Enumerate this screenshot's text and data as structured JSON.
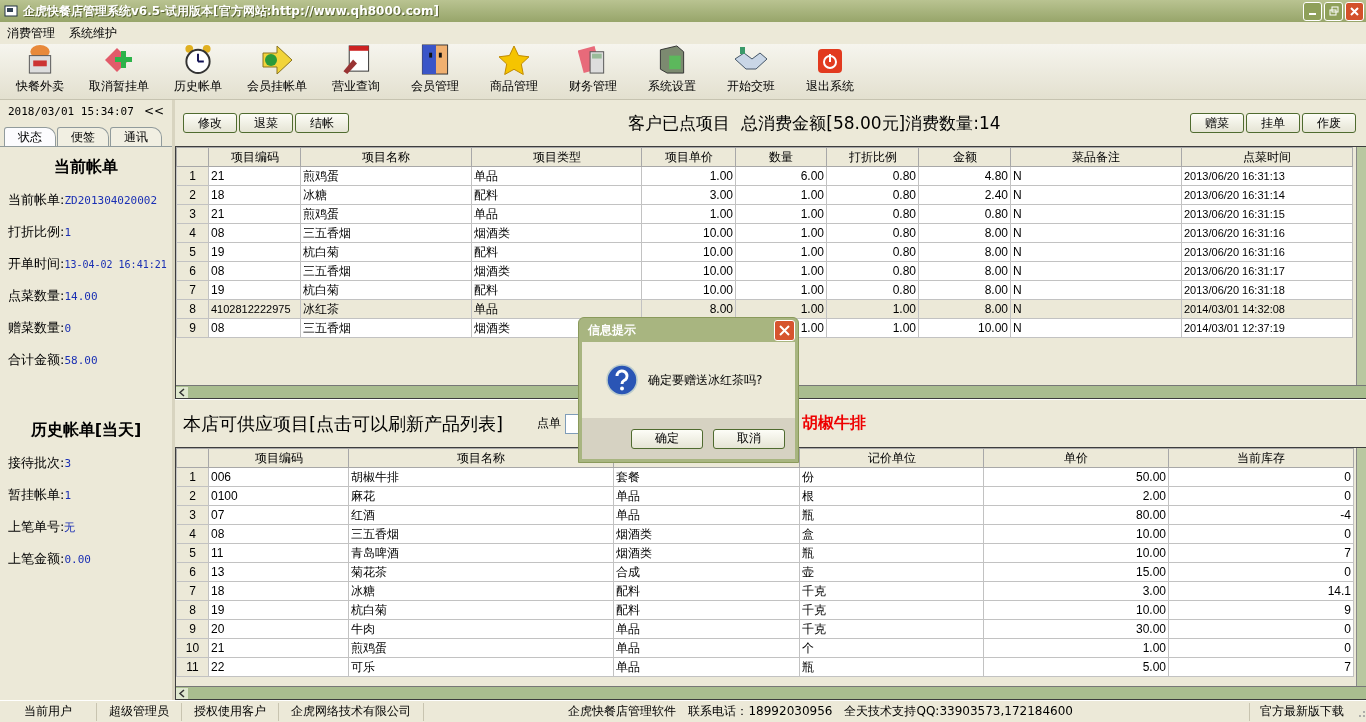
{
  "window": {
    "title": "企虎快餐店管理系统v6.5-试用版本[官方网站:http://www.qh8000.com]"
  },
  "menu": [
    "消费管理",
    "系统维护"
  ],
  "toolbar": [
    "快餐外卖",
    "取消暂挂单",
    "历史帐单",
    "会员挂帐单",
    "营业查询",
    "会员管理",
    "商品管理",
    "财务管理",
    "系统设置",
    "开始交班",
    "退出系统"
  ],
  "sidebar": {
    "datetime": "2018/03/01 15:34:07",
    "collapse": "<<",
    "tabs": [
      {
        "label": "状态",
        "selected": true
      },
      {
        "label": "便签",
        "selected": false
      },
      {
        "label": "通讯",
        "selected": false
      }
    ],
    "sections": [
      {
        "title": "当前帐单",
        "fields": [
          {
            "label": "当前帐单:",
            "value": "ZD201304020002"
          },
          {
            "label": "打折比例:",
            "value": "1"
          },
          {
            "label": "开单时间:",
            "value": "13-04-02 16:41:21"
          },
          {
            "label": "点菜数量:",
            "value": "14.00"
          },
          {
            "label": "赠菜数量:",
            "value": "0"
          },
          {
            "label": "合计金额:",
            "value": "58.00"
          }
        ]
      },
      {
        "title": "历史帐单[当天]",
        "fields": [
          {
            "label": "接待批次:",
            "value": "3"
          },
          {
            "label": "暂挂帐单:",
            "value": "1"
          },
          {
            "label": "上笔单号:",
            "value": "无"
          },
          {
            "label": "上笔金额:",
            "value": "0.00"
          }
        ]
      }
    ]
  },
  "order": {
    "left_buttons": [
      "修改",
      "退菜",
      "结帐"
    ],
    "summary": "客户已点项目  总消费金额[58.00元]消费数量:14",
    "right_buttons": [
      "赠菜",
      "挂单",
      "作废"
    ],
    "table": {
      "columns": [
        {
          "label": "项目编码",
          "kind": "text"
        },
        {
          "label": "项目名称",
          "kind": "text"
        },
        {
          "label": "项目类型",
          "kind": "text"
        },
        {
          "label": "项目单价",
          "kind": "number"
        },
        {
          "label": "数量",
          "kind": "number"
        },
        {
          "label": "打折比例",
          "kind": "number"
        },
        {
          "label": "金额",
          "kind": "number"
        },
        {
          "label": "菜品备注",
          "kind": "text"
        },
        {
          "label": "点菜时间",
          "kind": "text"
        }
      ],
      "rows": [
        {
          "index": "1",
          "selected": false,
          "cells": [
            "21",
            "煎鸡蛋",
            "单品",
            "1.00",
            "6.00",
            "0.80",
            "4.80",
            "N",
            "2013/06/20 16:31:13"
          ]
        },
        {
          "index": "2",
          "selected": false,
          "cells": [
            "18",
            "冰糖",
            "配料",
            "3.00",
            "1.00",
            "0.80",
            "2.40",
            "N",
            "2013/06/20 16:31:14"
          ]
        },
        {
          "index": "3",
          "selected": false,
          "cells": [
            "21",
            "煎鸡蛋",
            "单品",
            "1.00",
            "1.00",
            "0.80",
            "0.80",
            "N",
            "2013/06/20 16:31:15"
          ]
        },
        {
          "index": "4",
          "selected": false,
          "cells": [
            "08",
            "三五香烟",
            "烟酒类",
            "10.00",
            "1.00",
            "0.80",
            "8.00",
            "N",
            "2013/06/20 16:31:16"
          ]
        },
        {
          "index": "5",
          "selected": false,
          "cells": [
            "19",
            "杭白菊",
            "配料",
            "10.00",
            "1.00",
            "0.80",
            "8.00",
            "N",
            "2013/06/20 16:31:16"
          ]
        },
        {
          "index": "6",
          "selected": false,
          "cells": [
            "08",
            "三五香烟",
            "烟酒类",
            "10.00",
            "1.00",
            "0.80",
            "8.00",
            "N",
            "2013/06/20 16:31:17"
          ]
        },
        {
          "index": "7",
          "selected": false,
          "cells": [
            "19",
            "杭白菊",
            "配料",
            "10.00",
            "1.00",
            "0.80",
            "8.00",
            "N",
            "2013/06/20 16:31:18"
          ]
        },
        {
          "index": "8",
          "selected": true,
          "cells": [
            "4102812222975",
            "冰红茶",
            "单品",
            "8.00",
            "1.00",
            "1.00",
            "8.00",
            "N",
            "2014/03/01 14:32:08"
          ]
        },
        {
          "index": "9",
          "selected": false,
          "cells": [
            "08",
            "三五香烟",
            "烟酒类",
            null,
            "1.00",
            "1.00",
            "10.00",
            "N",
            "2014/03/01 12:37:19"
          ]
        }
      ]
    }
  },
  "products": {
    "title": "本店可供应项目[点击可以刷新产品列表]",
    "order_label": "点单",
    "current_item": "胡椒牛排",
    "table": {
      "columns": [
        {
          "label": "项目编码",
          "kind": "text"
        },
        {
          "label": "项目名称",
          "kind": "text"
        },
        {
          "kind": "text"
        },
        {
          "label": "记价单位",
          "kind": "text"
        },
        {
          "label": "单价",
          "kind": "number"
        },
        {
          "label": "当前库存",
          "kind": "number"
        }
      ],
      "rows": [
        {
          "index": "1",
          "selected": false,
          "cells": [
            "006",
            "胡椒牛排",
            "套餐",
            "份",
            "50.00",
            "0"
          ]
        },
        {
          "index": "2",
          "selected": false,
          "cells": [
            "0100",
            "麻花",
            "单品",
            "根",
            "2.00",
            "0"
          ]
        },
        {
          "index": "3",
          "selected": false,
          "cells": [
            "07",
            "红酒",
            "单品",
            "瓶",
            "80.00",
            "-4"
          ]
        },
        {
          "index": "4",
          "selected": false,
          "cells": [
            "08",
            "三五香烟",
            "烟酒类",
            "盒",
            "10.00",
            "0"
          ]
        },
        {
          "index": "5",
          "selected": false,
          "cells": [
            "11",
            "青岛啤酒",
            "烟酒类",
            "瓶",
            "10.00",
            "7"
          ]
        },
        {
          "index": "6",
          "selected": false,
          "cells": [
            "13",
            "菊花茶",
            "合成",
            "壶",
            "15.00",
            "0"
          ]
        },
        {
          "index": "7",
          "selected": false,
          "cells": [
            "18",
            "冰糖",
            "配料",
            "千克",
            "3.00",
            "14.1"
          ]
        },
        {
          "index": "8",
          "selected": false,
          "cells": [
            "19",
            "杭白菊",
            "配料",
            "千克",
            "10.00",
            "9"
          ]
        },
        {
          "index": "9",
          "selected": false,
          "cells": [
            "20",
            "牛肉",
            "单品",
            "千克",
            "30.00",
            "0"
          ]
        },
        {
          "index": "10",
          "selected": false,
          "cells": [
            "21",
            "煎鸡蛋",
            "单品",
            "个",
            "1.00",
            "0"
          ]
        },
        {
          "index": "11",
          "selected": false,
          "cells": [
            "22",
            "可乐",
            "单品",
            "瓶",
            "5.00",
            "7"
          ]
        }
      ]
    }
  },
  "dialog": {
    "title": "信息提示",
    "message": "确定要赠送冰红茶吗?",
    "buttons": [
      "确定",
      "取消"
    ]
  },
  "status_bar": {
    "left": [
      "当前用户",
      "超级管理员",
      "授权使用客户",
      "企虎网络技术有限公司"
    ],
    "center": [
      "企虎快餐店管理软件",
      "联系电话：18992030956",
      "全天技术支持QQ:33903573,172184600"
    ],
    "right": [
      "官方最新版下载"
    ]
  }
}
